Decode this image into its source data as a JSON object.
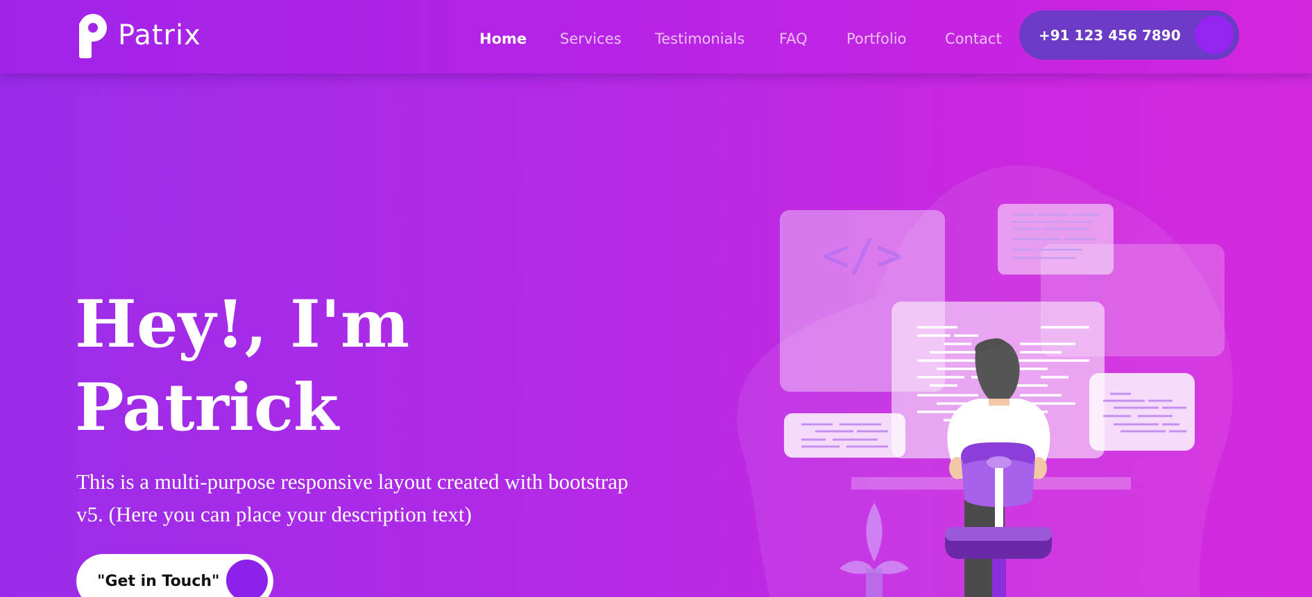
{
  "brand": {
    "name": "Patrix",
    "logo_letter": "P"
  },
  "nav": {
    "items": [
      {
        "label": "Home",
        "active": true
      },
      {
        "label": "Services",
        "active": false
      },
      {
        "label": "Testimonials",
        "active": false
      },
      {
        "label": "FAQ",
        "active": false
      },
      {
        "label": "Portfolio",
        "active": false
      },
      {
        "label": "Contact",
        "active": false
      }
    ],
    "phone": "+91 123 456 7890"
  },
  "hero": {
    "title_line1": "Hey!, I'm",
    "title_line2": "Patrick",
    "description": "This is a multi-purpose responsive layout created with bootstrap v5. (Here you can place your description text)",
    "cta_label": "\"Get in Touch\""
  },
  "illustration": {
    "code_symbol": "</>"
  },
  "colors": {
    "accent": "#9325ee",
    "phone_button": "#6b3bc6",
    "background_start": "#9a2ce9",
    "background_end": "#d42ade"
  }
}
